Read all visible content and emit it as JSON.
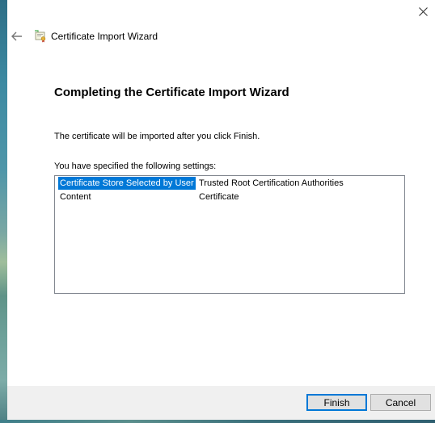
{
  "window": {
    "close_icon": "close-icon",
    "back_icon": "back-arrow-icon",
    "wizard_icon": "certificate-icon",
    "title": "Certificate Import Wizard"
  },
  "content": {
    "heading": "Completing the Certificate Import Wizard",
    "intro": "The certificate will be imported after you click Finish.",
    "settings_label": "You have specified the following settings:",
    "settings": [
      {
        "key": "Certificate Store Selected by User",
        "value": "Trusted Root Certification Authorities",
        "selected": true
      },
      {
        "key": "Content",
        "value": "Certificate",
        "selected": false
      }
    ]
  },
  "footer": {
    "finish_label": "Finish",
    "cancel_label": "Cancel"
  },
  "colors": {
    "accent": "#0078d7",
    "footer_bg": "#f0f0f0"
  }
}
